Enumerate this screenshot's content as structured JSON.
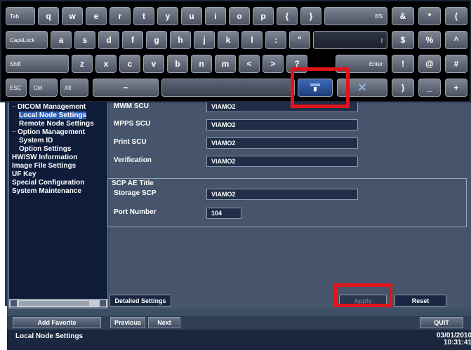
{
  "keyboard": {
    "row1": [
      "Tab",
      "q",
      "w",
      "e",
      "r",
      "t",
      "y",
      "u",
      "i",
      "o",
      "p",
      "{",
      "}",
      "BS",
      "&",
      "*",
      "("
    ],
    "row2": [
      "CapsLock",
      "a",
      "s",
      "d",
      "f",
      "g",
      "h",
      "j",
      "k",
      "l",
      ":",
      "\"",
      "|",
      "$",
      "%",
      "^"
    ],
    "row3": [
      "Shift",
      "z",
      "x",
      "c",
      "v",
      "b",
      "n",
      "m",
      "<",
      ">",
      "?",
      "Enter",
      "!",
      "@",
      "#"
    ],
    "row4": [
      "ESC",
      "Ctrl",
      "Alt",
      "~",
      ")",
      "_",
      "+"
    ]
  },
  "tree": {
    "items": [
      {
        "label": "DICOM Management",
        "indent": 0,
        "expander": "−"
      },
      {
        "label": "Local Node Settings",
        "indent": 2,
        "selected": true
      },
      {
        "label": "Remote Node Settings",
        "indent": 2
      },
      {
        "label": "Option Management",
        "indent": 0,
        "expander": "−"
      },
      {
        "label": "System ID",
        "indent": 2
      },
      {
        "label": "Option Settings",
        "indent": 2
      },
      {
        "label": "HW/SW Information",
        "indent": 0
      },
      {
        "label": "Image File Settings",
        "indent": 0
      },
      {
        "label": "UF Key",
        "indent": 0
      },
      {
        "label": "Special Configuration",
        "indent": 0
      },
      {
        "label": "System Maintenance",
        "indent": 0
      }
    ]
  },
  "form": {
    "rows": [
      {
        "label": "MWM SCU",
        "value": "VIAMO2"
      },
      {
        "label": "MPPS SCU",
        "value": "VIAMO2"
      },
      {
        "label": "Print SCU",
        "value": "VIAMO2"
      },
      {
        "label": "Verification",
        "value": "VIAMO2"
      }
    ],
    "scp_title": "SCP AE Title",
    "storage_label": "Storage SCP",
    "storage_value": "VIAMO2",
    "port_label": "Port Number",
    "port_value": "104"
  },
  "buttons": {
    "detailed": "Detailed Settings",
    "apply": "Apply",
    "reset": "Reset",
    "add_favorite": "Add Favorite",
    "previous": "Previous",
    "next": "Next",
    "quit": "QUIT"
  },
  "status": {
    "text": "Local Node Settings",
    "date": "03/01/2010",
    "time": "10:31:41"
  },
  "colors": {
    "highlight": "#e0141b",
    "selection": "#2d5fb8"
  }
}
